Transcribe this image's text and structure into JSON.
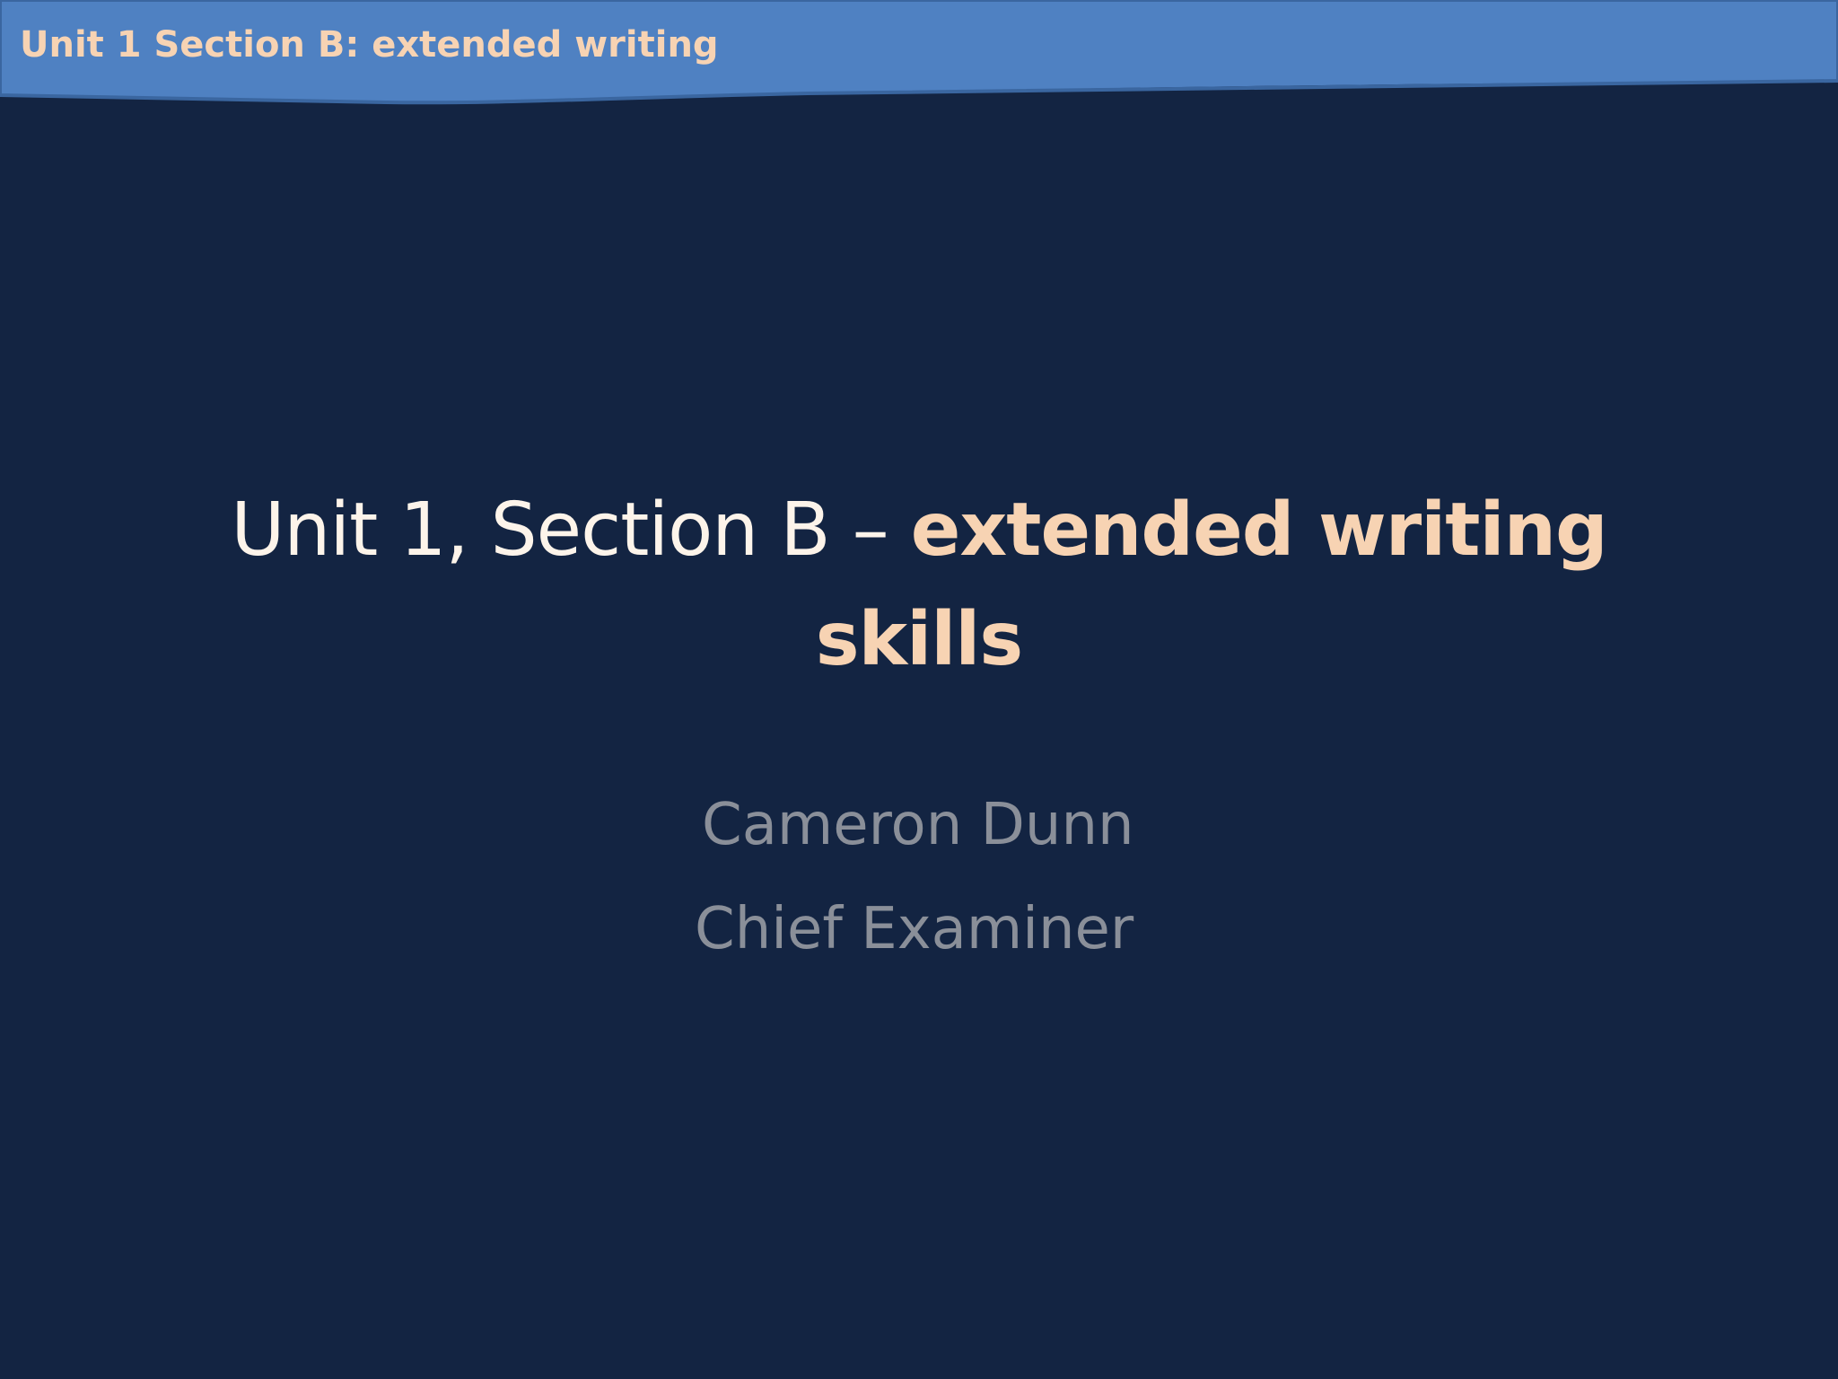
{
  "header": {
    "title": "Unit 1 Section B: extended writing"
  },
  "title_slide": {
    "title_plain": "Unit 1, Section B – ",
    "title_accent_line1": "extended writing",
    "title_accent_line2": "skills",
    "presenter_name": "Cameron Dunn",
    "presenter_role": "Chief Examiner"
  },
  "colors": {
    "background": "#132442",
    "header_band": "#4f81c2",
    "header_band_border": "#3a66a0",
    "accent_text": "#f7d3b3",
    "title_text": "#fdf4ea",
    "subtitle_text": "#8a8f99"
  }
}
